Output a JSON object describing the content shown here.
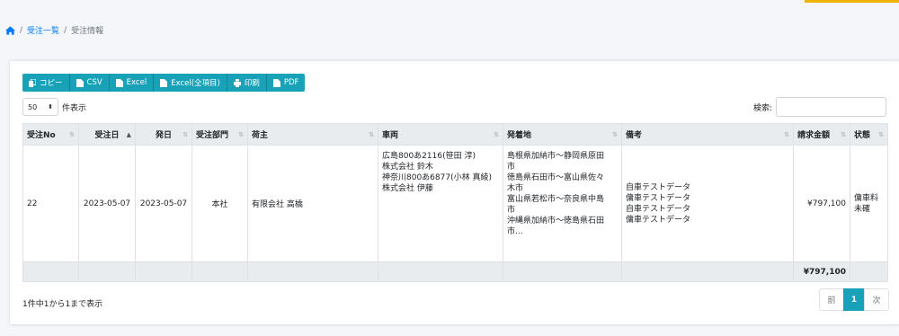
{
  "breadcrumb": {
    "home_icon": "home-icon",
    "items": [
      "受注一覧",
      "受注情報"
    ]
  },
  "toolbar": {
    "buttons": [
      {
        "label": "コピー",
        "icon": "copy-icon"
      },
      {
        "label": "CSV",
        "icon": "file-icon"
      },
      {
        "label": "Excel",
        "icon": "file-icon"
      },
      {
        "label": "Excel(全項目)",
        "icon": "file-icon"
      },
      {
        "label": "印刷",
        "icon": "print-icon"
      },
      {
        "label": "PDF",
        "icon": "file-icon"
      }
    ]
  },
  "length": {
    "value": "50",
    "label": "件表示"
  },
  "search": {
    "label": "検索:",
    "value": ""
  },
  "table": {
    "columns": [
      "受注No",
      "受注日",
      "発日",
      "受注部門",
      "荷主",
      "車両",
      "発着地",
      "備考",
      "請求金額",
      "状態"
    ],
    "row": {
      "no": "22",
      "order_date": "2023-05-07",
      "ship_date": "2023-05-07",
      "dept": "本社",
      "shipper": "有限会社 高橋",
      "vehicle": [
        "広島800あ2116(笹田 淳)",
        "株式会社 鈴木",
        "神奈川800あ6877(小林 真綾)",
        "株式会社 伊藤"
      ],
      "route": [
        "島根県加納市～静岡県原田",
        "市",
        "徳島県石田市～富山県佐々",
        "木市",
        "富山県若松市～奈良県中島",
        "市",
        "沖縄県加納市～徳島県石田",
        "市..."
      ],
      "note": [
        "自車テストデータ",
        "傭車テストデータ",
        "自車テストデータ",
        "傭車テストデータ"
      ],
      "amount": "¥797,100",
      "status": [
        "傭車料",
        "未確"
      ]
    },
    "total": "¥797,100"
  },
  "info": "1件中1から1まで表示",
  "pager": {
    "prev": "前",
    "page": "1",
    "next": "次"
  },
  "colors": {
    "accent": "#17a2b8",
    "link": "#007bff",
    "top_bar": "#f0b400"
  }
}
